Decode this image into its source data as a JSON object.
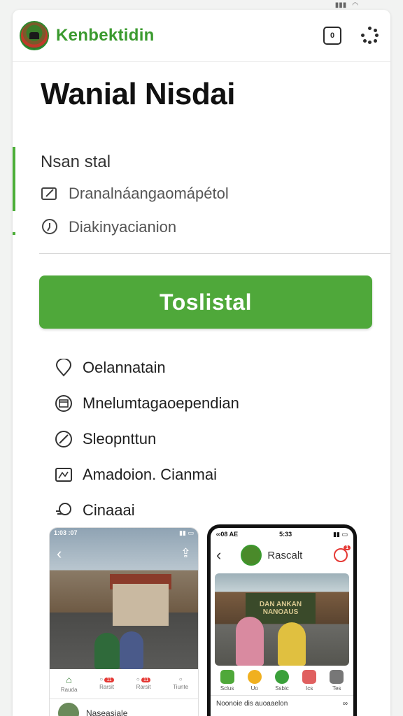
{
  "app": {
    "brand": "Kenbektidin",
    "title": "Wanial Nisdai",
    "colors": {
      "accent": "#4fa83a",
      "brand": "#3a9a2e"
    }
  },
  "header": {
    "icons": [
      "square-icon",
      "dots-grid-icon"
    ],
    "square_label": "0"
  },
  "info": {
    "title": "Nsan stal",
    "rows": [
      {
        "icon": "edit-icon",
        "label": "Dranalnáangaomápétol"
      },
      {
        "icon": "location-icon",
        "label": "Diakinyacianion"
      }
    ]
  },
  "cta": {
    "label": "Toslistal"
  },
  "menu": [
    {
      "icon": "pin-icon",
      "label": "Oelannatain"
    },
    {
      "icon": "calendar-icon",
      "label": "Mnelumtagaoependian"
    },
    {
      "icon": "compass-icon",
      "label": "Sleopnttun"
    },
    {
      "icon": "map-icon",
      "label": "Amadoion. Cianmai"
    },
    {
      "icon": "chat-icon",
      "label": "Cinaaai"
    }
  ],
  "phone1": {
    "status_time": "1:03 :07",
    "nav": [
      {
        "label": "Rauda",
        "badge": ""
      },
      {
        "label": "Rarsit",
        "badge": "11"
      },
      {
        "label": "Rarsit",
        "badge": "11"
      },
      {
        "label": "Tiunte",
        "badge": ""
      }
    ],
    "footer_label": "Naseasiale"
  },
  "phone2": {
    "status_time": "5:33",
    "status_left": "∞08 AE",
    "title": "Rascalt",
    "notification_count": "1",
    "sign_text": "DAN ANKAN NANOAUS",
    "tabs": [
      {
        "label": "Sclus",
        "color": "#4fa83a"
      },
      {
        "label": "Uo",
        "color": "#f0b020"
      },
      {
        "label": "Ssbic",
        "color": "#3aa03a"
      },
      {
        "label": "Ics",
        "color": "#e06060"
      },
      {
        "label": "Tes",
        "color": "#777777"
      }
    ],
    "bottom_label": "Noonoie dis auoaaelon"
  }
}
